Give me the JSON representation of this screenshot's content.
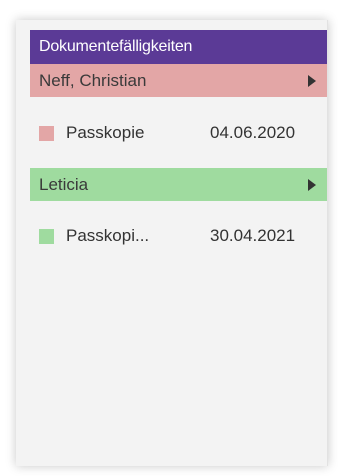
{
  "panel": {
    "title": "Dokumentefälligkeiten",
    "header_color": "#5b3a96"
  },
  "groups": [
    {
      "name": "Neff, Christian",
      "color": "#e3a6a6",
      "documents": [
        {
          "name": "Passkopie",
          "date": "04.06.2020",
          "color": "#e3a6a6"
        }
      ]
    },
    {
      "name": "Leticia",
      "color": "#9fdb9f",
      "documents": [
        {
          "name": "Passkopi...",
          "date": "30.04.2021",
          "color": "#9fdb9f"
        }
      ]
    }
  ]
}
